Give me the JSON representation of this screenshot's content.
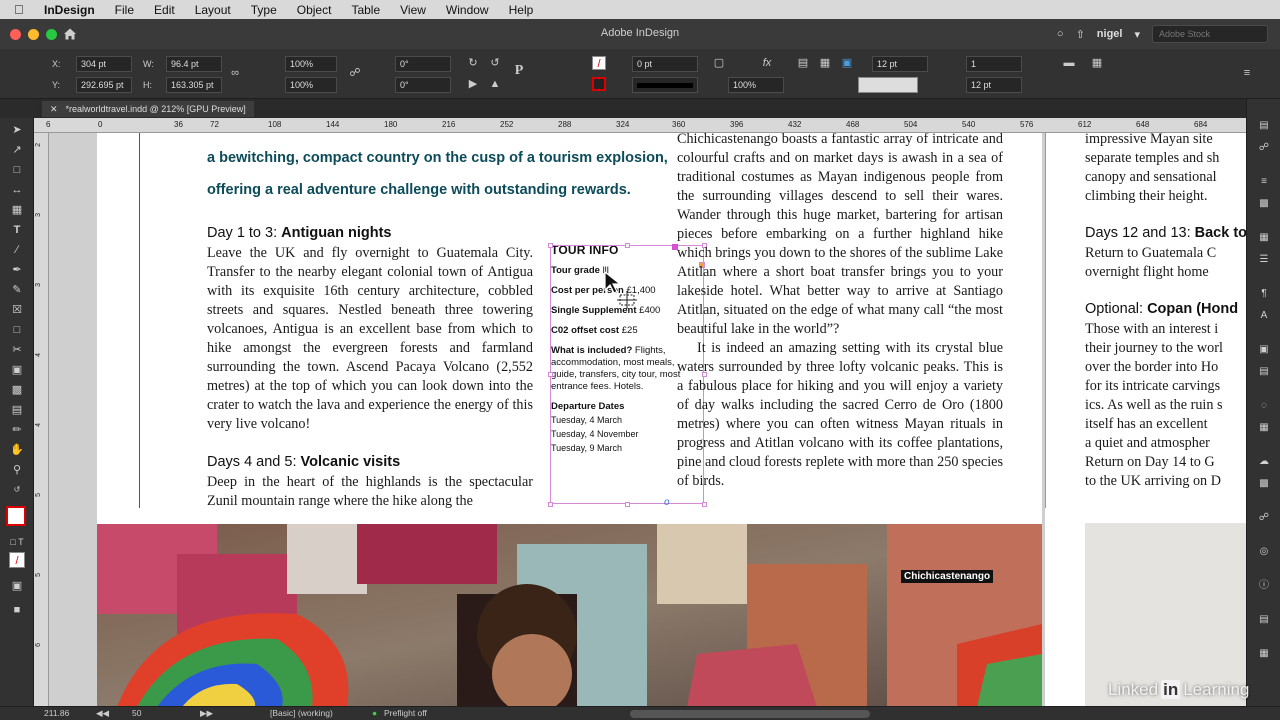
{
  "menubar": {
    "app": "InDesign",
    "items": [
      "File",
      "Edit",
      "Layout",
      "Type",
      "Object",
      "Table",
      "View",
      "Window",
      "Help"
    ]
  },
  "window": {
    "title": "Adobe InDesign",
    "user": "nigel",
    "stock_placeholder": "Adobe Stock"
  },
  "control_panel": {
    "x_label": "X:",
    "x_value": "304 pt",
    "y_label": "Y:",
    "y_value": "292.695 pt",
    "w_label": "W:",
    "w_value": "96.4 pt",
    "h_label": "H:",
    "h_value": "163.305 pt",
    "scale_x": "100%",
    "scale_y": "100%",
    "rotate": "0°",
    "shear": "0°",
    "stroke_weight": "0 pt",
    "opacity": "100%",
    "gutter": "12 pt",
    "columns": "1",
    "col_width": "12 pt"
  },
  "document_tab": {
    "name": "*realworldtravel.indd @ 212% [GPU Preview]"
  },
  "ruler": {
    "h_ticks": [
      "6",
      "0",
      "36",
      "72",
      "108",
      "144",
      "180",
      "216",
      "252",
      "288",
      "324",
      "360",
      "396",
      "432",
      "468",
      "504",
      "540",
      "576",
      "612",
      "648",
      "684"
    ],
    "v_ticks": [
      "2",
      "3",
      "3",
      "4",
      "4",
      "5",
      "5",
      "6"
    ]
  },
  "page": {
    "intro_lines": [
      "a bewitching, compact country on the cusp of a tourism explosion,",
      "offering a real adventure challenge with outstanding rewards."
    ],
    "section1_prefix": "Day 1 to 3: ",
    "section1_title": "Antiguan nights",
    "section1_body": "Leave the UK and fly overnight to Guatemala City. Transfer to the nearby elegant colonial town of Antigua with its exquisite 16th century architecture, cobbled streets and squares. Nestled beneath three towering volcanoes, Antigua is an excellent base from which to hike amongst the evergreen forests and farmland surrounding the town. Ascend Pacaya Volcano (2,552 metres) at the top of which you can look down into the crater to watch the lava and experience the energy of this very live volcano!",
    "section2_prefix": "Days 4 and 5: ",
    "section2_title": "Volcanic visits",
    "section2_body": "Deep in the heart of the highlands is the spectacular Zunil mountain range where the hike along the",
    "col2_para1": "Chichicastenango boasts a fantastic array of intricate and colourful crafts and on market days is awash in a sea of traditional costumes as Mayan indigenous people from the surrounding villages descend to sell their wares. Wander through this huge market, bartering for artisan pieces before embarking on a further highland hike which brings you down to the shores of the sublime Lake Atitlan where a short boat transfer brings you to your lakeside hotel. What better way to arrive at Santiago Atitlan, situated on the edge of what many call “the most beautiful lake in the world”?",
    "col2_para2": "It is indeed an amazing setting with its crystal blue waters surrounded by three lofty volcanic peaks. This is a fabulous place for hiking and you will enjoy a variety of day walks including the sacred Cerro de Oro (1800 metres) where you can often witness Mayan rituals in progress and Atitlan volcano with its coffee plantations, pine and cloud forests replete with more than 250 species of birds.",
    "tour_info": {
      "title": "TOUR INFO",
      "grade_label": "Tour grade",
      "grade_value": "lll",
      "cost_label": "Cost per person",
      "cost_value": "£1,400",
      "single_label": "Single Supplement",
      "single_value": "£400",
      "co2_label": "C02 offset cost",
      "co2_value": "£25",
      "included_label": "What is included?",
      "included_value": "Flights, accommodation, most meals, guide, transfers, city tour, most entrance fees. Hotels.",
      "departure_label": "Departure Dates",
      "dates": [
        "Tuesday, 4 March",
        "Tuesday, 4 November",
        "Tuesday, 9 March"
      ]
    },
    "photo_caption": "Chichicastenango"
  },
  "page2": {
    "lines1": [
      "impressive Mayan site",
      "separate temples and sh",
      "canopy and sensational",
      "climbing their height."
    ],
    "head1_prefix": "Days 12 and 13: ",
    "head1_title": "Back to t",
    "lines2": [
      "Return to Guatemala C",
      "overnight flight home"
    ],
    "head2_prefix": "Optional: ",
    "head2_title": "Copan (Hond",
    "lines3": [
      "Those with an interest i",
      "their journey to the worl",
      "over the border into Ho",
      "for its intricate carvings",
      "ics. As well as the ruin s",
      "itself has an excellent",
      "a quiet and atmospher",
      "Return on Day 14 to G",
      "to the UK arriving on D"
    ]
  },
  "status": {
    "zoom": "211.86",
    "page": "50",
    "profile": "[Basic] (working)",
    "preflight": "Preflight off"
  },
  "watermark": {
    "pre": "Linked",
    "in": "in",
    "post": "Learning"
  },
  "colors": {
    "intro": "#0b4b5a",
    "selection": "#d58ad8",
    "traffic_red": "#fe5f57",
    "traffic_yellow": "#febc2e",
    "traffic_green": "#28c840"
  }
}
